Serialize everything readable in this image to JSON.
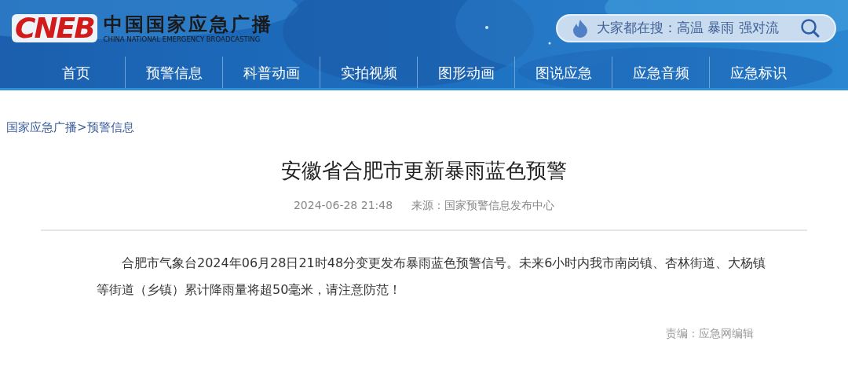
{
  "header": {
    "logo": "CNEB",
    "site_name": "中国国家应急广播",
    "site_name_en": "CHINA NATIONAL EMERGENCY BROADCASTING",
    "search": {
      "placeholder": "大家都在搜：高温 暴雨 强对流"
    }
  },
  "nav": [
    {
      "label": "首页"
    },
    {
      "label": "预警信息"
    },
    {
      "label": "科普动画"
    },
    {
      "label": "实拍视频"
    },
    {
      "label": "图形动画"
    },
    {
      "label": "图说应急"
    },
    {
      "label": "应急音频"
    },
    {
      "label": "应急标识"
    }
  ],
  "breadcrumb": [
    "国家应急广播",
    ">",
    "预警信息"
  ],
  "article": {
    "title": "安徽省合肥市更新暴雨蓝色预警",
    "date": "2024-06-28 21:48",
    "source": "来源：国家预警信息发布中心",
    "body": "合肥市气象台2024年06月28日21时48分变更发布暴雨蓝色预警信号。未来6小时内我市南岗镇、杏林街道、大杨镇等街道（乡镇）累计降雨量将超50毫米，请注意防范！",
    "editor": "责编：应急网编辑"
  }
}
